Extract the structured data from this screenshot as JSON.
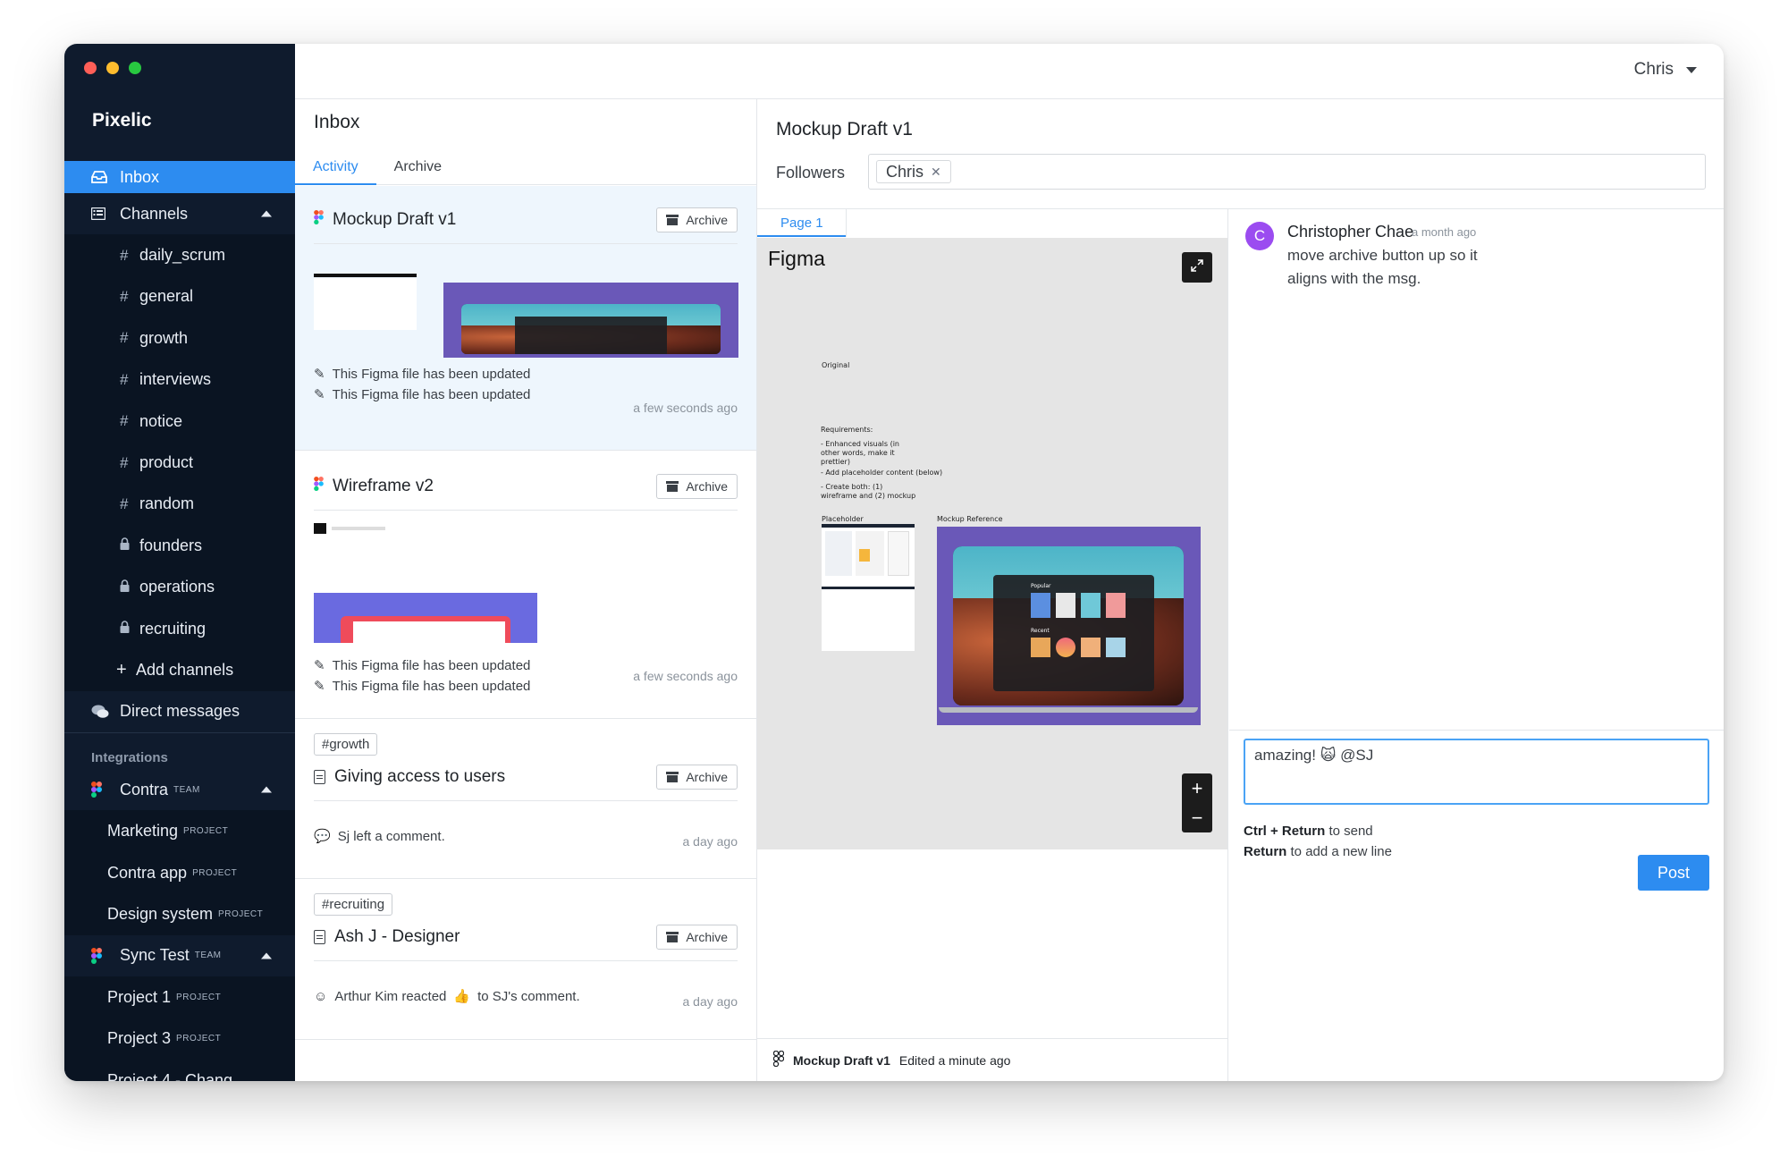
{
  "app": {
    "name": "Pixelic"
  },
  "topbar": {
    "user": "Chris"
  },
  "sidebar": {
    "inbox_label": "Inbox",
    "channels_label": "Channels",
    "channels": [
      {
        "prefix": "#",
        "name": "daily_scrum"
      },
      {
        "prefix": "#",
        "name": "general"
      },
      {
        "prefix": "#",
        "name": "growth"
      },
      {
        "prefix": "#",
        "name": "interviews"
      },
      {
        "prefix": "#",
        "name": "notice"
      },
      {
        "prefix": "#",
        "name": "product"
      },
      {
        "prefix": "#",
        "name": "random"
      },
      {
        "prefix": "lock",
        "name": "founders"
      },
      {
        "prefix": "lock",
        "name": "operations"
      },
      {
        "prefix": "lock",
        "name": "recruiting"
      }
    ],
    "add_channels": "Add channels",
    "direct_messages": "Direct messages",
    "integrations_label": "Integrations",
    "teams": [
      {
        "name": "Contra",
        "tag": "TEAM",
        "projects": [
          {
            "name": "Marketing",
            "tag": "PROJECT"
          },
          {
            "name": "Contra app",
            "tag": "PROJECT"
          },
          {
            "name": "Design system",
            "tag": "PROJECT"
          }
        ]
      },
      {
        "name": "Sync Test",
        "tag": "TEAM",
        "projects": [
          {
            "name": "Project 1",
            "tag": "PROJECT"
          },
          {
            "name": "Project 3",
            "tag": "PROJECT"
          },
          {
            "name": "Project 4 - Chang",
            "tag": ""
          }
        ]
      }
    ]
  },
  "inbox": {
    "title": "Inbox",
    "tabs": [
      "Activity",
      "Archive"
    ],
    "archive_label": "Archive",
    "items": [
      {
        "title": "Mockup Draft v1",
        "lines": [
          "This Figma file has been updated",
          "This Figma file has been updated"
        ],
        "time": "a few seconds ago"
      },
      {
        "title": "Wireframe v2",
        "lines": [
          "This Figma file has been updated",
          "This Figma file has been updated"
        ],
        "time": "a few seconds ago"
      },
      {
        "tag": "#growth",
        "title": "Giving access to users",
        "line": "Sj left a comment.",
        "time": "a day ago"
      },
      {
        "tag": "#recruiting",
        "title": "Ash J - Designer",
        "line_before": "Arthur Kim reacted",
        "emoji": "👍",
        "line_after": "to SJ's comment.",
        "time": "a day ago"
      }
    ]
  },
  "detail": {
    "title": "Mockup Draft v1",
    "followers_label": "Followers",
    "followers": [
      "Chris"
    ],
    "page_tab": "Page 1",
    "canvas": {
      "heading": "Figma",
      "original": "Original",
      "requirements_title": "Requirements:",
      "requirements": [
        "- Enhanced visuals (in other words, make it prettier)",
        "- Add placeholder content (below)",
        "- Create both: (1) wireframe and (2) mockup"
      ],
      "placeholder": "Placeholder",
      "mockup_reference": "Mockup Reference",
      "popular": "Popular",
      "recent": "Recent"
    },
    "footer": {
      "file": "Mockup Draft v1",
      "edited": "Edited a minute ago"
    }
  },
  "comments": {
    "items": [
      {
        "initial": "C",
        "author": "Christopher Chae",
        "time": "a month ago",
        "body": "move archive button up so it aligns with the msg."
      }
    ],
    "draft": "amazing! 🙀 @SJ",
    "hint1_key": "Ctrl + Return",
    "hint1_text": "to send",
    "hint2_key": "Return",
    "hint2_text": "to add a new line",
    "post_label": "Post"
  },
  "colors": {
    "sidebar_bg": "#0f1b2d",
    "accent": "#2d8cf0",
    "avatar": "#9b4cf0"
  }
}
